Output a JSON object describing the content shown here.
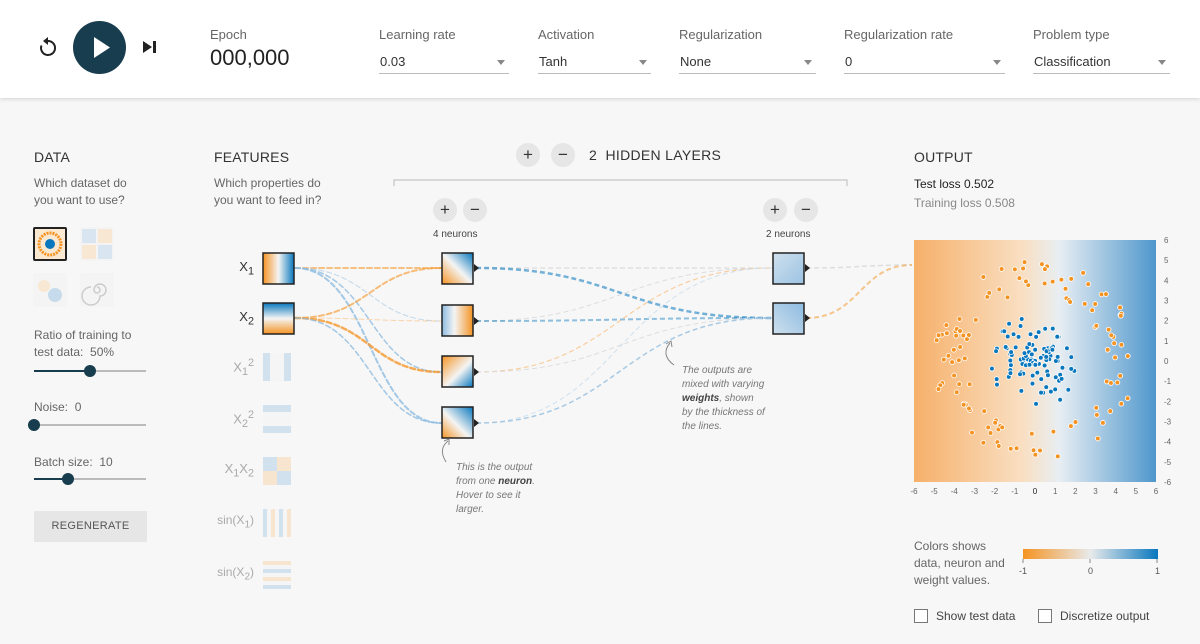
{
  "top": {
    "epoch_label": "Epoch",
    "epoch_value": "000,000",
    "controls": [
      {
        "label": "Learning rate",
        "value": "0.03"
      },
      {
        "label": "Activation",
        "value": "Tanh"
      },
      {
        "label": "Regularization",
        "value": "None"
      },
      {
        "label": "Regularization rate",
        "value": "0"
      },
      {
        "label": "Problem type",
        "value": "Classification"
      }
    ]
  },
  "data_panel": {
    "title": "DATA",
    "subtitle_1": "Which dataset do",
    "subtitle_2": "you want to use?",
    "ratio_label_1": "Ratio of training to",
    "ratio_label_2": "test data:",
    "ratio_value": "50%",
    "ratio_fraction": 0.5,
    "noise_label": "Noise:",
    "noise_value": "0",
    "noise_fraction": 0,
    "batch_label": "Batch size:",
    "batch_value": "10",
    "batch_fraction": 0.3,
    "regenerate": "REGENERATE"
  },
  "features_panel": {
    "title": "FEATURES",
    "subtitle_1": "Which properties do",
    "subtitle_2": "you want to feed in?"
  },
  "network": {
    "layer_count": "2",
    "layers_label": "HIDDEN LAYERS",
    "layer1_neurons": "4 neurons",
    "layer2_neurons": "2 neurons",
    "note_neuron": [
      "This is the output",
      "from one",
      "neuron",
      ". Hover to see it",
      "larger."
    ],
    "note_weights": [
      "The outputs are",
      "mixed with varying",
      "weights",
      ", shown",
      "by the thickness of",
      "the lines."
    ]
  },
  "output_panel": {
    "title": "OUTPUT",
    "test_loss": "Test loss 0.502",
    "training_loss": "Training loss 0.508",
    "axis_ticks": [
      "-6",
      "-5",
      "-4",
      "-3",
      "-2",
      "-1",
      "0",
      "1",
      "2",
      "3",
      "4",
      "5",
      "6"
    ],
    "legend_text_1": "Colors shows",
    "legend_text_2": "data, neuron and",
    "legend_text_3": "weight values.",
    "legend_min": "-1",
    "legend_mid": "0",
    "legend_max": "1",
    "show_test_data": "Show test data",
    "discretize_output": "Discretize output"
  },
  "colors": {
    "orange": "#f59322",
    "blue": "#0877bd",
    "dark": "#183d4e"
  }
}
